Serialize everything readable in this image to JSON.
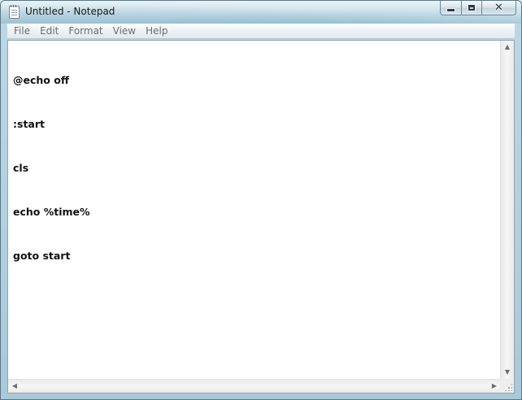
{
  "window": {
    "title": "Untitled - Notepad",
    "icon": "notepad-icon"
  },
  "caption_buttons": {
    "minimize_icon": "minimize-icon",
    "maximize_icon": "maximize-icon",
    "close_icon": "close-icon",
    "close_glyph": "✕"
  },
  "menu": {
    "items": [
      {
        "label": "File"
      },
      {
        "label": "Edit"
      },
      {
        "label": "Format"
      },
      {
        "label": "View"
      },
      {
        "label": "Help"
      }
    ]
  },
  "editor": {
    "lines": [
      "@echo off",
      ":start",
      "cls",
      "echo %time%",
      "goto start"
    ]
  },
  "scrollbars": {
    "up_glyph": "▲",
    "down_glyph": "▼",
    "left_glyph": "◀",
    "right_glyph": "▶"
  },
  "colors": {
    "menu_text": "#6c6c6c",
    "editor_text": "#111111",
    "frame_border": "#5d7687"
  }
}
